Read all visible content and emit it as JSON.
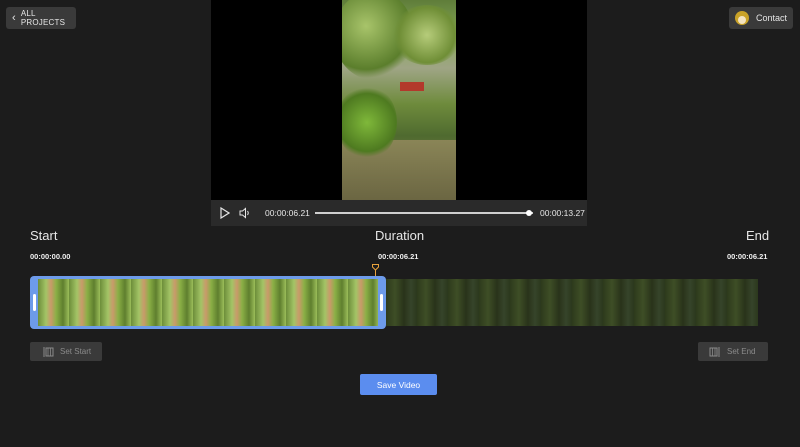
{
  "header": {
    "back_label": "ALL PROJECTS",
    "contact_label": "Contact"
  },
  "player": {
    "current_time": "00:00:06.21",
    "total_time": "00:00:13.27",
    "progress": 0.98
  },
  "trim": {
    "start_label": "Start",
    "duration_label": "Duration",
    "end_label": "End",
    "start_time": "00:00:00.00",
    "duration_time": "00:00:06.21",
    "end_time": "00:00:06.21",
    "set_start_label": "Set Start",
    "set_end_label": "Set End"
  },
  "save_label": "Save Video",
  "colors": {
    "background": "#1c1c1c",
    "accent": "#5b8def",
    "selection": "#6d9bea",
    "playhead": "#e8a23c"
  }
}
